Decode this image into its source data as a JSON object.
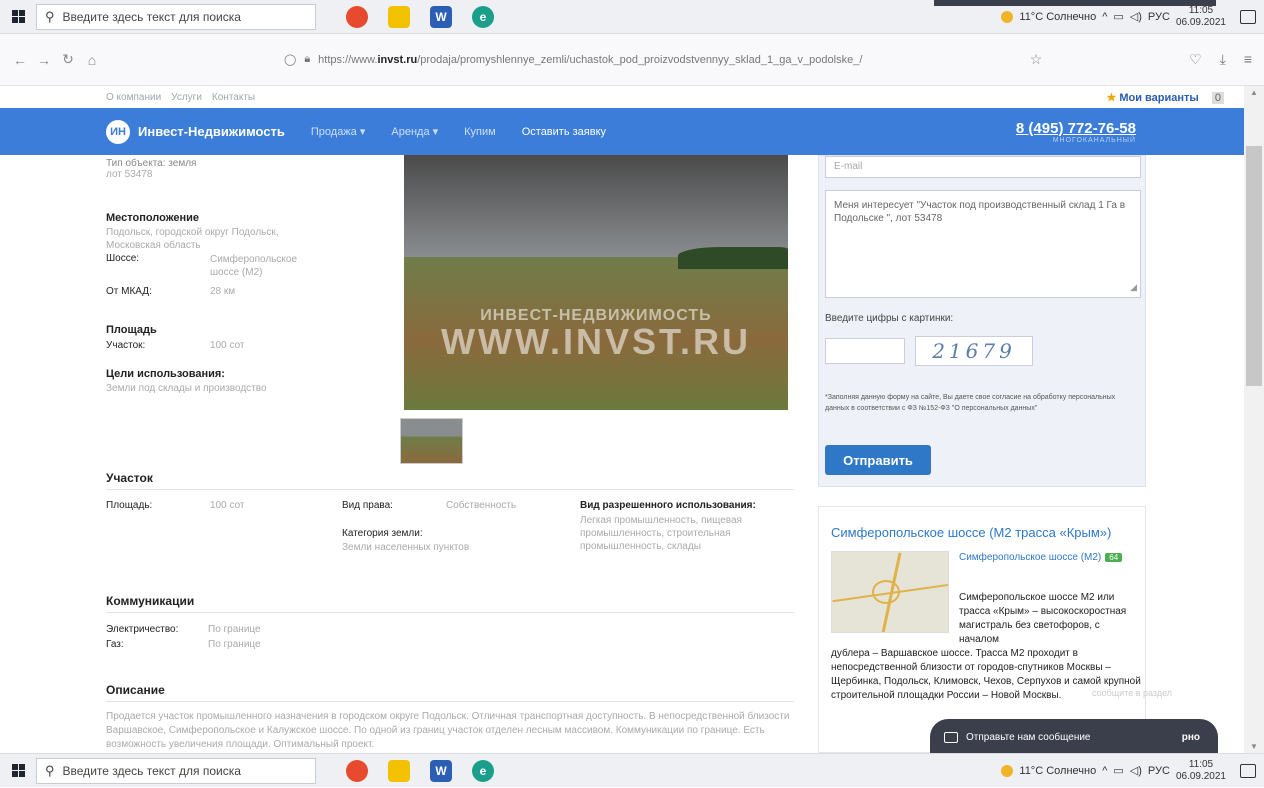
{
  "taskbar": {
    "search_placeholder": "Введите здесь текст для поиска",
    "weather": "11°C Солнечно",
    "lang": "РУС",
    "time": "11:05",
    "date": "06.09.2021"
  },
  "browser": {
    "url_prefix": "https://www.",
    "url_domain": "invst.ru",
    "url_path": "/prodaja/promyshlennye_zemli/uchastok_pod_proizvodstvennyy_sklad_1_ga_v_podolske_/"
  },
  "site": {
    "top_links": [
      "О компании",
      "Услуги",
      "Контакты"
    ],
    "favorites": "Мои варианты",
    "favorites_count": "0",
    "logo_text": "ИН",
    "brand": "Инвест-Недвижимость",
    "nav": [
      "Продажа ▾",
      "Аренда ▾",
      "Купим",
      "Оставить заявку"
    ],
    "phone": "8 (495) 772-76-58",
    "phone_sub": "МНОГОКАНАЛЬНЫЙ"
  },
  "listing": {
    "id_label": "Тип объекта: земля",
    "id_value": "лот 53478",
    "location_title": "Местоположение",
    "location_value": "Подольск, городской округ Подольск, Московская область",
    "highway_label": "Шоссе:",
    "highway_value": "Симферопольское шоссе (М2)",
    "mkad_label": "От МКАД:",
    "mkad_value": "28 км",
    "area_title": "Площадь",
    "plot_label": "Участок:",
    "plot_value": "100 сот",
    "purpose_title": "Цели использования:",
    "purpose_value": "Земли под склады и производство"
  },
  "photo": {
    "watermark_top": "ИНВЕСТ-НЕДВИЖИМОСТЬ",
    "watermark_main": "WWW.INVST.RU"
  },
  "plot": {
    "title": "Участок",
    "area_label": "Площадь:",
    "area_value": "100 сот",
    "right_label": "Вид права:",
    "right_value": "Собственность",
    "category_label": "Категория земли:",
    "category_value": "Земли населенных пунктов",
    "permitted_label": "Вид разрешенного использования:",
    "permitted_value": "Легкая промышленность, пищевая промышленность, строительная промышленность, склады"
  },
  "utilities": {
    "title": "Коммуникации",
    "power_label": "Электричество:",
    "power_value": "По границе",
    "gas_label": "Газ:",
    "gas_value": "По границе"
  },
  "description": {
    "title": "Описание",
    "text": "Продается участок промышленного назначения в городском округе Подольск. Отличная транспортная доступность. В непосредственной близости Варшавское, Симферопольское и Калужское шоссе. По одной из границ участок отделен лесным массивом. Коммуникации по границе. Есть возможность увеличения площади. Оптимальный проект."
  },
  "form": {
    "email_placeholder": "E-mail",
    "message": "Меня интересует \"Участок под производственный склад 1 Га в Подольске \", лот 53478",
    "captcha_label": "Введите цифры с картинки:",
    "captcha_code": "21679",
    "consent": "*Заполняя данную форму на сайте, Вы даете свое согласие на обработку персональных данных в соответствии с ФЗ №152-ФЗ \"О персональных данных\"",
    "submit": "Отправить"
  },
  "highway_card": {
    "title": "Симферопольское шоссе (М2 трасса «Крым»)",
    "link": "Симферопольское шоссе (М2)",
    "badge": "64",
    "text_right": "Симферопольское шоссе М2 или трасса «Крым» – высокоскоростная магистраль без светофоров, с началом",
    "text_full": "дублера – Варшавское шоссе. Трасса М2 проходит в непосредственной близости от городов-спутников Москвы – Щербинка, Подольск, Климовск, Чехов, Серпухов и самой крупной строительной площадки России – Новой Москвы."
  },
  "chat": {
    "label": "Отправьте нам сообщение",
    "extra": "рно",
    "hint": "сообщите в раздел"
  }
}
